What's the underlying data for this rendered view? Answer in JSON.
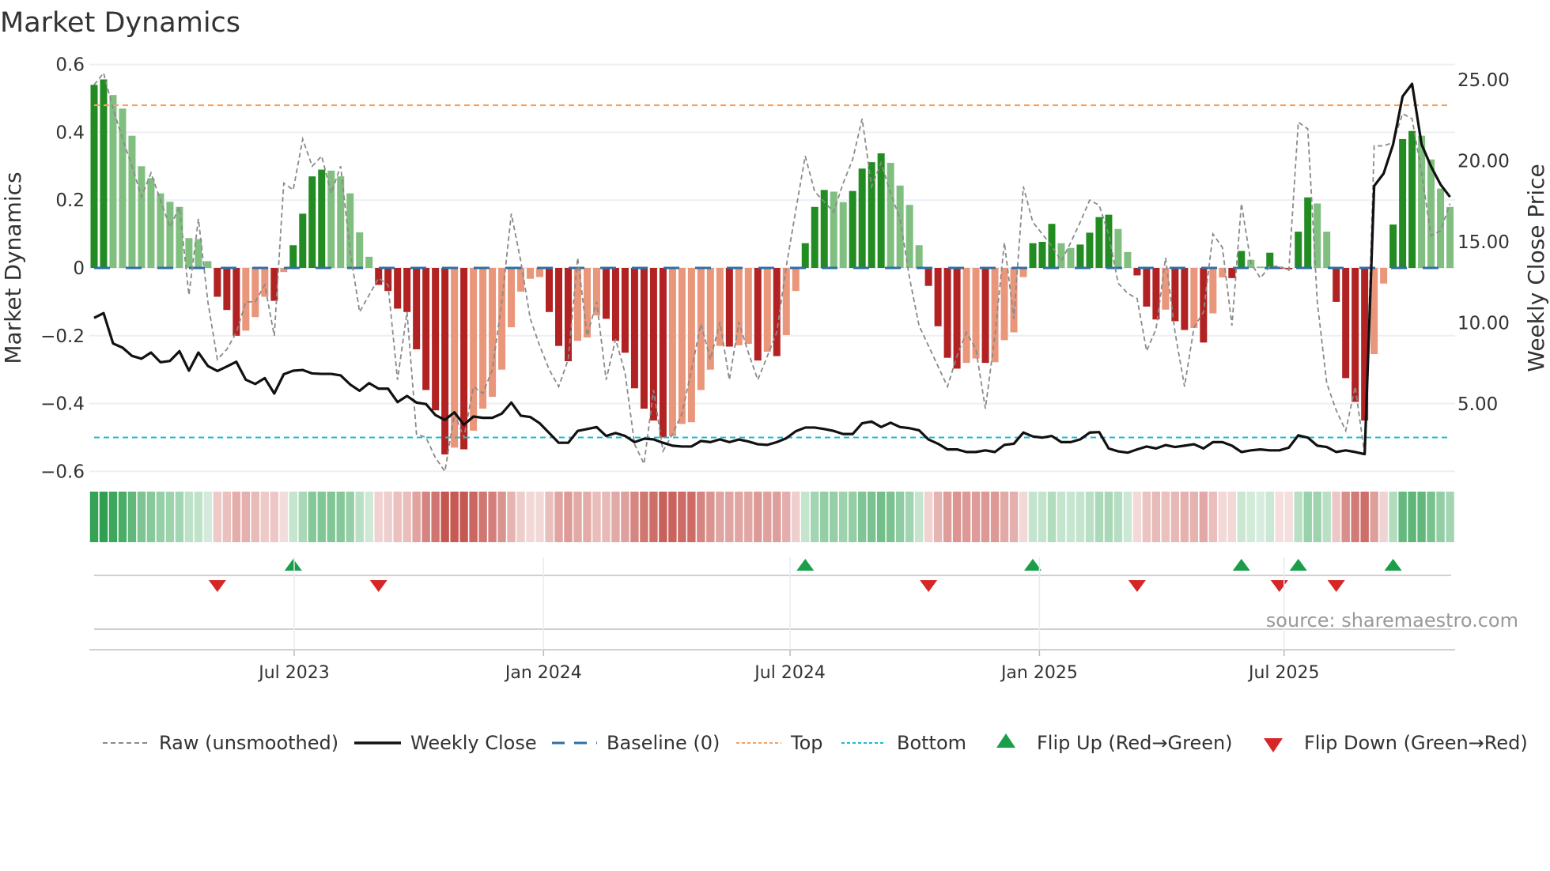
{
  "chart_data": {
    "type": "bar",
    "title": "Market Dynamics",
    "ylabel": "Market Dynamics",
    "y2label": "Weekly Close Price",
    "ylim": [
      -0.6,
      0.6
    ],
    "y2lim": [
      0,
      27.4
    ],
    "yticks": [
      "0.6",
      "0.4",
      "0.2",
      "0",
      "−0.2",
      "−0.4",
      "−0.6"
    ],
    "ytick_values": [
      0.6,
      0.4,
      0.2,
      0,
      -0.2,
      -0.4,
      -0.6
    ],
    "y2ticks": [
      "25.00",
      "20.00",
      "15.00",
      "10.00",
      "5.00"
    ],
    "y2tick_values": [
      25,
      20,
      15,
      10,
      5
    ],
    "xticks": [
      {
        "label": "Jul 2023",
        "week": 21.1
      },
      {
        "label": "Jan 2024",
        "week": 47.4
      },
      {
        "label": "Jul 2024",
        "week": 73.4
      },
      {
        "label": "Jan 2025",
        "week": 99.7
      },
      {
        "label": "Jul 2025",
        "week": 125.5
      }
    ],
    "top_level": 0.48,
    "bottom_level": -0.5,
    "baseline": 0,
    "series": [
      {
        "name": "Market Dynamics (smoothed)",
        "type": "bar",
        "values": [
          0.54,
          0.556,
          0.51,
          0.47,
          0.39,
          0.3,
          0.265,
          0.22,
          0.195,
          0.18,
          0.088,
          0.085,
          0.02,
          -0.085,
          -0.124,
          -0.2,
          -0.185,
          -0.145,
          -0.085,
          -0.097,
          -0.012,
          0.067,
          0.16,
          0.27,
          0.29,
          0.287,
          0.27,
          0.22,
          0.105,
          0.033,
          -0.05,
          -0.068,
          -0.12,
          -0.13,
          -0.24,
          -0.36,
          -0.42,
          -0.55,
          -0.53,
          -0.535,
          -0.48,
          -0.415,
          -0.38,
          -0.3,
          -0.175,
          -0.07,
          -0.032,
          -0.027,
          -0.13,
          -0.23,
          -0.275,
          -0.215,
          -0.205,
          -0.14,
          -0.15,
          -0.215,
          -0.25,
          -0.355,
          -0.415,
          -0.45,
          -0.5,
          -0.496,
          -0.46,
          -0.455,
          -0.36,
          -0.3,
          -0.23,
          -0.232,
          -0.228,
          -0.224,
          -0.273,
          -0.247,
          -0.26,
          -0.198,
          -0.068,
          0.073,
          0.18,
          0.23,
          0.225,
          0.194,
          0.227,
          0.293,
          0.312,
          0.338,
          0.31,
          0.243,
          0.186,
          0.067,
          -0.053,
          -0.172,
          -0.265,
          -0.297,
          -0.28,
          -0.267,
          -0.28,
          -0.278,
          -0.213,
          -0.19,
          -0.027,
          0.073,
          0.077,
          0.13,
          0.073,
          0.059,
          0.069,
          0.104,
          0.15,
          0.157,
          0.115,
          0.047,
          -0.022,
          -0.114,
          -0.152,
          -0.123,
          -0.157,
          -0.183,
          -0.177,
          -0.22,
          -0.134,
          -0.028,
          -0.03,
          0.05,
          0.024,
          0.004,
          0.045,
          -0.003,
          -0.004,
          0.107,
          0.208,
          0.19,
          0.107,
          -0.1,
          -0.325,
          -0.395,
          -0.45,
          -0.254,
          -0.046,
          0.128,
          0.38,
          0.404,
          0.39,
          0.32,
          0.234,
          0.18
        ]
      },
      {
        "name": "Raw (unsmoothed)",
        "type": "line",
        "values": [
          0.54,
          0.575,
          0.47,
          0.38,
          0.3,
          0.21,
          0.28,
          0.2,
          0.12,
          0.18,
          -0.08,
          0.145,
          -0.1,
          -0.27,
          -0.24,
          -0.19,
          -0.1,
          -0.1,
          -0.05,
          -0.2,
          0.25,
          0.23,
          0.38,
          0.3,
          0.33,
          0.22,
          0.3,
          0.05,
          -0.13,
          -0.08,
          -0.03,
          -0.05,
          -0.33,
          -0.13,
          -0.49,
          -0.5,
          -0.56,
          -0.6,
          -0.43,
          -0.5,
          -0.35,
          -0.37,
          -0.3,
          -0.1,
          0.16,
          0.02,
          -0.15,
          -0.23,
          -0.3,
          -0.35,
          -0.27,
          0.03,
          -0.2,
          -0.1,
          -0.33,
          -0.21,
          -0.31,
          -0.52,
          -0.578,
          -0.36,
          -0.54,
          -0.49,
          -0.43,
          -0.3,
          -0.165,
          -0.27,
          -0.16,
          -0.33,
          -0.16,
          -0.25,
          -0.33,
          -0.26,
          -0.19,
          0.005,
          0.17,
          0.33,
          0.225,
          0.195,
          0.165,
          0.25,
          0.32,
          0.44,
          0.24,
          0.31,
          0.22,
          0.145,
          -0.03,
          -0.17,
          -0.23,
          -0.29,
          -0.35,
          -0.26,
          -0.19,
          -0.24,
          -0.415,
          -0.2,
          0.075,
          -0.15,
          0.24,
          0.135,
          0.1,
          0.065,
          0.02,
          0.075,
          0.135,
          0.2,
          0.185,
          0.1,
          -0.045,
          -0.075,
          -0.09,
          -0.245,
          -0.18,
          0.03,
          -0.19,
          -0.35,
          -0.175,
          -0.13,
          0.1,
          0.06,
          -0.17,
          0.19,
          0.015,
          -0.03,
          0.005,
          0.005,
          -0.007,
          0.43,
          0.41,
          -0.1,
          -0.34,
          -0.42,
          -0.48,
          -0.35,
          -0.55,
          0.36,
          0.36,
          0.37,
          0.455,
          0.44,
          0.28,
          0.095,
          0.11,
          0.19
        ]
      },
      {
        "name": "Weekly Close",
        "type": "line",
        "axis": "right",
        "values": [
          10.31,
          10.6,
          8.73,
          8.47,
          7.96,
          7.79,
          8.17,
          7.57,
          7.65,
          8.25,
          7.05,
          8.17,
          7.34,
          7.03,
          7.31,
          7.6,
          6.49,
          6.23,
          6.59,
          5.64,
          6.83,
          7.05,
          7.09,
          6.88,
          6.85,
          6.85,
          6.76,
          6.2,
          5.81,
          6.28,
          5.94,
          5.94,
          5.11,
          5.49,
          5.08,
          4.99,
          4.31,
          4.01,
          4.48,
          3.71,
          4.22,
          4.14,
          4.14,
          4.4,
          5.08,
          4.27,
          4.19,
          3.8,
          3.2,
          2.6,
          2.6,
          3.33,
          3.45,
          3.57,
          3.02,
          3.2,
          3.02,
          2.64,
          2.85,
          2.81,
          2.6,
          2.42,
          2.37,
          2.37,
          2.71,
          2.64,
          2.81,
          2.64,
          2.8,
          2.68,
          2.51,
          2.47,
          2.64,
          2.88,
          3.31,
          3.54,
          3.54,
          3.45,
          3.33,
          3.14,
          3.14,
          3.8,
          3.91,
          3.57,
          3.84,
          3.57,
          3.5,
          3.37,
          2.8,
          2.54,
          2.19,
          2.19,
          2.03,
          2.03,
          2.13,
          2.03,
          2.47,
          2.54,
          3.23,
          2.99,
          2.92,
          3.02,
          2.64,
          2.64,
          2.81,
          3.23,
          3.26,
          2.25,
          2.07,
          1.99,
          2.19,
          2.37,
          2.25,
          2.46,
          2.34,
          2.42,
          2.51,
          2.25,
          2.64,
          2.64,
          2.42,
          2.03,
          2.13,
          2.19,
          2.13,
          2.13,
          2.3,
          3.06,
          2.92,
          2.42,
          2.34,
          2.03,
          2.13,
          2.03,
          1.9,
          18.45,
          19.22,
          21.02,
          23.98,
          24.75,
          21.02,
          19.65,
          18.54,
          17.77
        ]
      }
    ],
    "flip_up_weeks": [
      21,
      75,
      99,
      121,
      127,
      137
    ],
    "flip_down_weeks": [
      13,
      30,
      88,
      110,
      125,
      131
    ],
    "colors": {
      "strong_up": "#228b22",
      "weak_up": "#80bf80",
      "strong_down": "#b22222",
      "weak_down": "#e9967a",
      "raw": "#8a8a8a",
      "close": "#111111",
      "baseline": "#2f6fa5",
      "top": "#f4a261",
      "bottom": "#17becf",
      "flip_up": "#1a9e4a",
      "flip_down": "#d62728"
    },
    "legend": {
      "position": "bottom",
      "items": [
        "Raw (unsmoothed)",
        "Weekly Close",
        "Baseline (0)",
        "Top",
        "Bottom",
        "Flip Up (Red→Green)",
        "Flip Down (Green→Red)"
      ]
    },
    "source": "source: sharemaestro.com"
  }
}
